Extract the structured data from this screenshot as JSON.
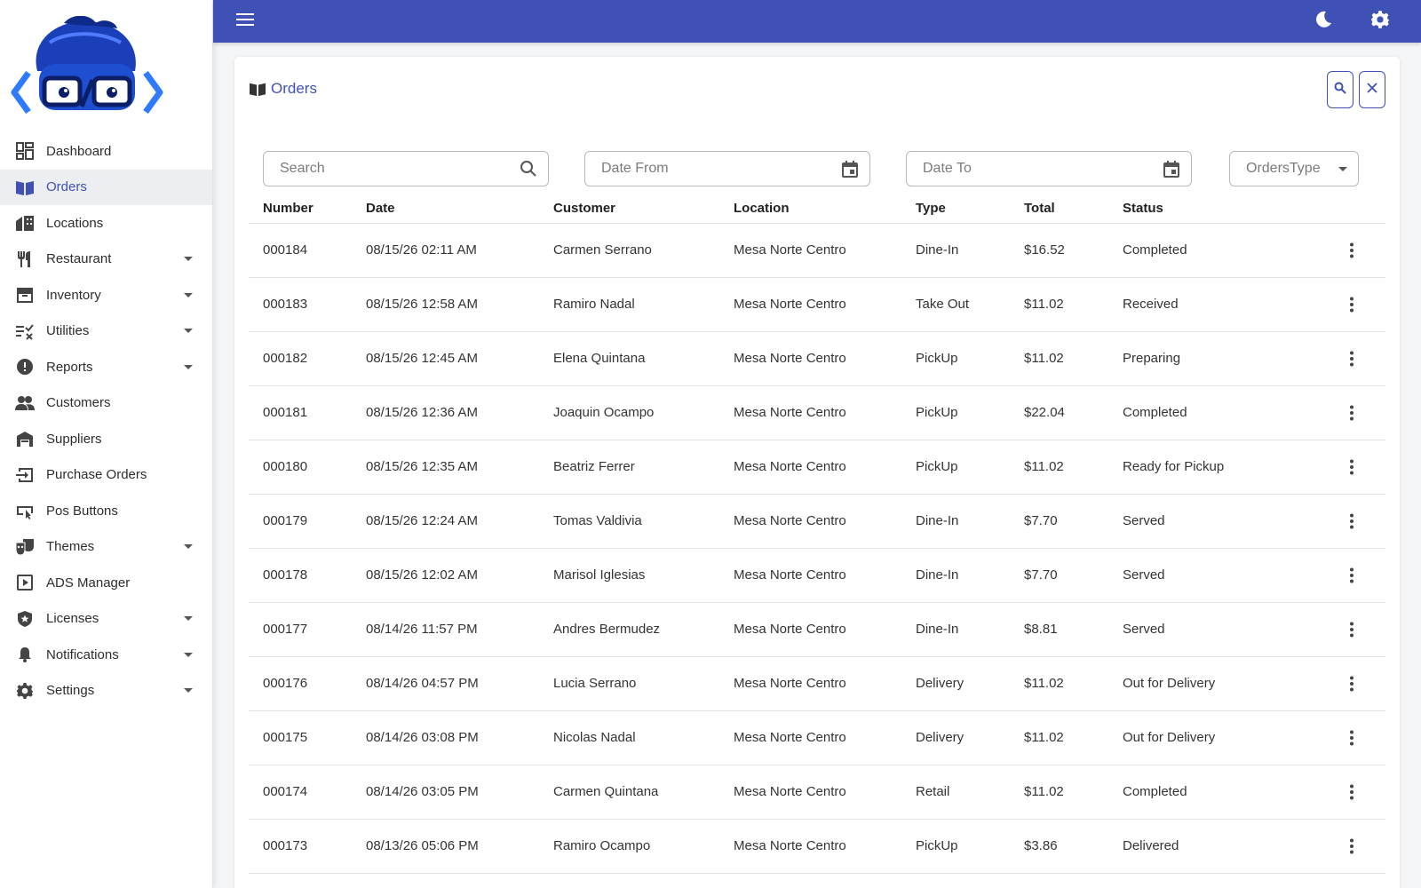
{
  "sidebar": {
    "items": [
      {
        "label": "Dashboard",
        "icon": "dashboard-icon",
        "expandable": false,
        "active": false
      },
      {
        "label": "Orders",
        "icon": "book-icon",
        "expandable": false,
        "active": true
      },
      {
        "label": "Locations",
        "icon": "store-icon",
        "expandable": false,
        "active": false
      },
      {
        "label": "Restaurant",
        "icon": "fork-knife-icon",
        "expandable": true,
        "active": false
      },
      {
        "label": "Inventory",
        "icon": "archive-icon",
        "expandable": true,
        "active": false
      },
      {
        "label": "Utilities",
        "icon": "checklist-icon",
        "expandable": true,
        "active": false
      },
      {
        "label": "Reports",
        "icon": "alert-circle-icon",
        "expandable": true,
        "active": false
      },
      {
        "label": "Customers",
        "icon": "people-icon",
        "expandable": false,
        "active": false
      },
      {
        "label": "Suppliers",
        "icon": "warehouse-icon",
        "expandable": false,
        "active": false
      },
      {
        "label": "Purchase Orders",
        "icon": "login-box-icon",
        "expandable": false,
        "active": false
      },
      {
        "label": "Pos Buttons",
        "icon": "button-cursor-icon",
        "expandable": false,
        "active": false
      },
      {
        "label": "Themes",
        "icon": "theater-icon",
        "expandable": true,
        "active": false
      },
      {
        "label": "ADS Manager",
        "icon": "play-box-icon",
        "expandable": false,
        "active": false
      },
      {
        "label": "Licenses",
        "icon": "shield-star-icon",
        "expandable": true,
        "active": false
      },
      {
        "label": "Notifications",
        "icon": "bell-icon",
        "expandable": true,
        "active": false
      },
      {
        "label": "Settings",
        "icon": "gear-icon",
        "expandable": true,
        "active": false
      }
    ]
  },
  "topbar": {
    "color": "#3f51b5"
  },
  "page": {
    "title": "Orders"
  },
  "filters": {
    "search_placeholder": "Search",
    "date_from_placeholder": "Date From",
    "date_to_placeholder": "Date To",
    "orders_type_label": "OrdersType"
  },
  "table": {
    "columns": [
      "Number",
      "Date",
      "Customer",
      "Location",
      "Type",
      "Total",
      "Status"
    ],
    "rows": [
      [
        "000184",
        "08/15/26 02:11 AM",
        "Carmen Serrano",
        "Mesa Norte Centro",
        "Dine-In",
        "$16.52",
        "Completed"
      ],
      [
        "000183",
        "08/15/26 12:58 AM",
        "Ramiro Nadal",
        "Mesa Norte Centro",
        "Take Out",
        "$11.02",
        "Received"
      ],
      [
        "000182",
        "08/15/26 12:45 AM",
        "Elena Quintana",
        "Mesa Norte Centro",
        "PickUp",
        "$11.02",
        "Preparing"
      ],
      [
        "000181",
        "08/15/26 12:36 AM",
        "Joaquin Ocampo",
        "Mesa Norte Centro",
        "PickUp",
        "$22.04",
        "Completed"
      ],
      [
        "000180",
        "08/15/26 12:35 AM",
        "Beatriz Ferrer",
        "Mesa Norte Centro",
        "PickUp",
        "$11.02",
        "Ready for Pickup"
      ],
      [
        "000179",
        "08/15/26 12:24 AM",
        "Tomas Valdivia",
        "Mesa Norte Centro",
        "Dine-In",
        "$7.70",
        "Served"
      ],
      [
        "000178",
        "08/15/26 12:02 AM",
        "Marisol Iglesias",
        "Mesa Norte Centro",
        "Dine-In",
        "$7.70",
        "Served"
      ],
      [
        "000177",
        "08/14/26 11:57 PM",
        "Andres Bermudez",
        "Mesa Norte Centro",
        "Dine-In",
        "$8.81",
        "Served"
      ],
      [
        "000176",
        "08/14/26 04:57 PM",
        "Lucia Serrano",
        "Mesa Norte Centro",
        "Delivery",
        "$11.02",
        "Out for Delivery"
      ],
      [
        "000175",
        "08/14/26 03:08 PM",
        "Nicolas Nadal",
        "Mesa Norte Centro",
        "Delivery",
        "$11.02",
        "Out for Delivery"
      ],
      [
        "000174",
        "08/14/26 03:05 PM",
        "Carmen Quintana",
        "Mesa Norte Centro",
        "Retail",
        "$11.02",
        "Completed"
      ],
      [
        "000173",
        "08/13/26 05:06 PM",
        "Ramiro Ocampo",
        "Mesa Norte Centro",
        "PickUp",
        "$3.86",
        "Delivered"
      ]
    ]
  }
}
